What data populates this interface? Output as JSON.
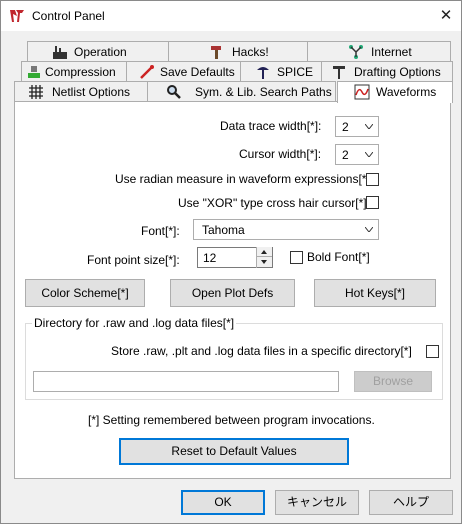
{
  "window": {
    "title": "Control Panel",
    "close_glyph": "✕",
    "app_icon": "ltspice-logo-icon"
  },
  "tabs": {
    "row1": [
      {
        "label": "Operation",
        "icon": "factory-icon"
      },
      {
        "label": "Hacks!",
        "icon": "hammer-icon"
      },
      {
        "label": "Internet",
        "icon": "network-icon"
      }
    ],
    "row2": [
      {
        "label": "Compression",
        "icon": "compression-icon"
      },
      {
        "label": "Save Defaults",
        "icon": "probe-icon"
      },
      {
        "label": "SPICE",
        "icon": "spice-icon"
      },
      {
        "label": "Drafting Options",
        "icon": "drafting-t-icon"
      }
    ],
    "row3": [
      {
        "label": "Netlist Options",
        "icon": "netlist-grid-icon"
      },
      {
        "label": "Sym. & Lib. Search Paths",
        "icon": "magnifier-icon"
      },
      {
        "label": "Waveforms",
        "icon": "waveform-icon",
        "active": true
      }
    ]
  },
  "waveforms": {
    "data_trace_width": {
      "label": "Data trace width[*]:",
      "value": "2"
    },
    "cursor_width": {
      "label": "Cursor width[*]:",
      "value": "2"
    },
    "radian_measure": {
      "label": "Use radian measure in waveform expressions[*]",
      "checked": false
    },
    "xor_cursor": {
      "label": "Use \"XOR\" type cross hair cursor[*]",
      "checked": false
    },
    "font": {
      "label": "Font[*]:",
      "value": "Tahoma"
    },
    "font_point_size": {
      "label": "Font point size[*]:",
      "value": "12"
    },
    "bold_font": {
      "label": "Bold Font[*]",
      "checked": false
    },
    "buttons": {
      "color_scheme": "Color Scheme[*]",
      "open_plot_defs": "Open Plot Defs",
      "hot_keys": "Hot Keys[*]"
    },
    "directory_group": {
      "label": "Directory for .raw and .log data files[*]",
      "store_label": "Store .raw, .plt and .log data files in a specific directory[*]",
      "store_checked": false,
      "path_value": "",
      "browse_label": "Browse"
    },
    "remembered_note": "[*] Setting remembered between program invocations.",
    "reset_label": "Reset to Default Values"
  },
  "footer": {
    "ok": "OK",
    "cancel": "キャンセル",
    "help": "ヘルプ"
  }
}
